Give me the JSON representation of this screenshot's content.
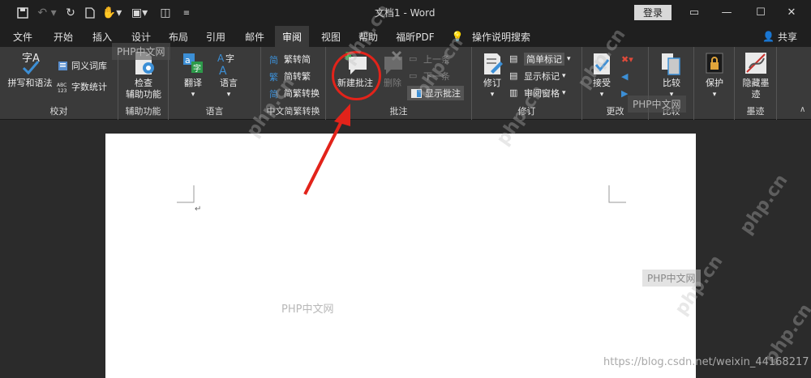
{
  "titlebar": {
    "title": "文档1  -  Word",
    "login": "登录",
    "quick_access": [
      "save-icon",
      "undo-icon",
      "redo-icon",
      "new-doc-icon",
      "touch-mode-icon",
      "format-icon",
      "page-icon",
      "customize-icon"
    ],
    "window_buttons": {
      "ribbon_options": "▭",
      "minimize": "—",
      "maximize": "☐",
      "close": "✕"
    }
  },
  "tabs": [
    "文件",
    "开始",
    "插入",
    "设计",
    "布局",
    "引用",
    "邮件",
    "审阅",
    "视图",
    "帮助",
    "福昕PDF",
    "操作说明搜索"
  ],
  "active_tab": "审阅",
  "share": "共享",
  "ribbon": {
    "proofing": {
      "label": "校对",
      "spelling": "拼写和语法",
      "thesaurus": "同义词库",
      "word_count": "字数统计"
    },
    "accessibility": {
      "label": "辅助功能",
      "check": "检查\n辅助功能"
    },
    "language": {
      "label": "语言",
      "translate": "翻译",
      "language": "语言"
    },
    "chinese_conversion": {
      "label": "中文简繁转换",
      "to_simplified": "繁转简",
      "to_traditional": "简转繁",
      "conversion": "简繁转换"
    },
    "comments": {
      "label": "批注",
      "new_comment": "新建批注",
      "delete": "删除",
      "previous": "上一条",
      "next": "下一条",
      "show_comments": "显示批注"
    },
    "tracking": {
      "label": "修订",
      "track_changes": "修订",
      "markup_mode": "简单标记",
      "show_markup": "显示标记",
      "reviewing_pane": "审阅窗格"
    },
    "changes": {
      "label": "更改",
      "accept": "接受"
    },
    "compare": {
      "label": "比较",
      "compare": "比较"
    },
    "protect": {
      "label": "",
      "protect": "保护"
    },
    "ink": {
      "label": "墨迹",
      "hide_ink": "隐藏墨\n迹"
    }
  },
  "watermarks": [
    "PHP中文网",
    "PHP中文网",
    "PHP中文网",
    "PHP中文网",
    "PHP中文网"
  ],
  "credit": "https://blog.csdn.net/weixin_44168217",
  "colors": {
    "accent_red": "#e2231a",
    "ribbon_bg": "#3a3a3a",
    "title_bg": "#1f1f1f"
  }
}
